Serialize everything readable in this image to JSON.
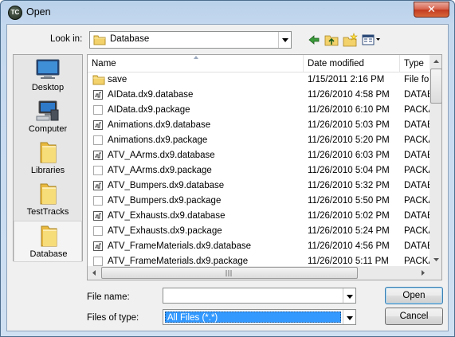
{
  "window": {
    "title": "Open",
    "close_glyph": "✕",
    "app_icon_text": "TC"
  },
  "lookin": {
    "label": "Look in:",
    "value": "Database"
  },
  "toolbar": {
    "icons": [
      "back-icon",
      "up-folder-icon",
      "new-folder-icon",
      "view-menu-icon"
    ]
  },
  "places": [
    {
      "label": "Desktop",
      "icon": "desktop-icon"
    },
    {
      "label": "Computer",
      "icon": "computer-icon"
    },
    {
      "label": "Libraries",
      "icon": "libraries-icon"
    },
    {
      "label": "TestTracks",
      "icon": "folder-icon"
    },
    {
      "label": "Database",
      "icon": "folder-icon",
      "selected": true
    }
  ],
  "columns": {
    "name": "Name",
    "date": "Date modified",
    "type": "Type"
  },
  "files": [
    {
      "name": "save",
      "date": "1/15/2011 2:16 PM",
      "type": "File fol",
      "kind": "folder"
    },
    {
      "name": "AIData.dx9.database",
      "date": "11/26/2010 4:58 PM",
      "type": "DATAB",
      "kind": "database"
    },
    {
      "name": "AIData.dx9.package",
      "date": "11/26/2010 6:10 PM",
      "type": "PACKA",
      "kind": "package"
    },
    {
      "name": "Animations.dx9.database",
      "date": "11/26/2010 5:03 PM",
      "type": "DATAB",
      "kind": "database"
    },
    {
      "name": "Animations.dx9.package",
      "date": "11/26/2010 5:20 PM",
      "type": "PACKA",
      "kind": "package"
    },
    {
      "name": "ATV_AArms.dx9.database",
      "date": "11/26/2010 6:03 PM",
      "type": "DATAB",
      "kind": "database"
    },
    {
      "name": "ATV_AArms.dx9.package",
      "date": "11/26/2010 5:04 PM",
      "type": "PACKA",
      "kind": "package"
    },
    {
      "name": "ATV_Bumpers.dx9.database",
      "date": "11/26/2010 5:32 PM",
      "type": "DATAB",
      "kind": "database"
    },
    {
      "name": "ATV_Bumpers.dx9.package",
      "date": "11/26/2010 5:50 PM",
      "type": "PACKA",
      "kind": "package"
    },
    {
      "name": "ATV_Exhausts.dx9.database",
      "date": "11/26/2010 5:02 PM",
      "type": "DATAB",
      "kind": "database"
    },
    {
      "name": "ATV_Exhausts.dx9.package",
      "date": "11/26/2010 5:24 PM",
      "type": "PACKA",
      "kind": "package"
    },
    {
      "name": "ATV_FrameMaterials.dx9.database",
      "date": "11/26/2010 4:56 PM",
      "type": "DATAB",
      "kind": "database"
    },
    {
      "name": "ATV_FrameMaterials.dx9.package",
      "date": "11/26/2010 5:11 PM",
      "type": "PACKA",
      "kind": "package"
    }
  ],
  "filename": {
    "label": "File name:",
    "value": ""
  },
  "filetype": {
    "label": "Files of type:",
    "value": "All Files (*.*)"
  },
  "buttons": {
    "open": "Open",
    "cancel": "Cancel"
  },
  "colors": {
    "selection": "#3399ff",
    "folder": "#f3d26b",
    "title_gradient_top": "#b9d1ea"
  }
}
